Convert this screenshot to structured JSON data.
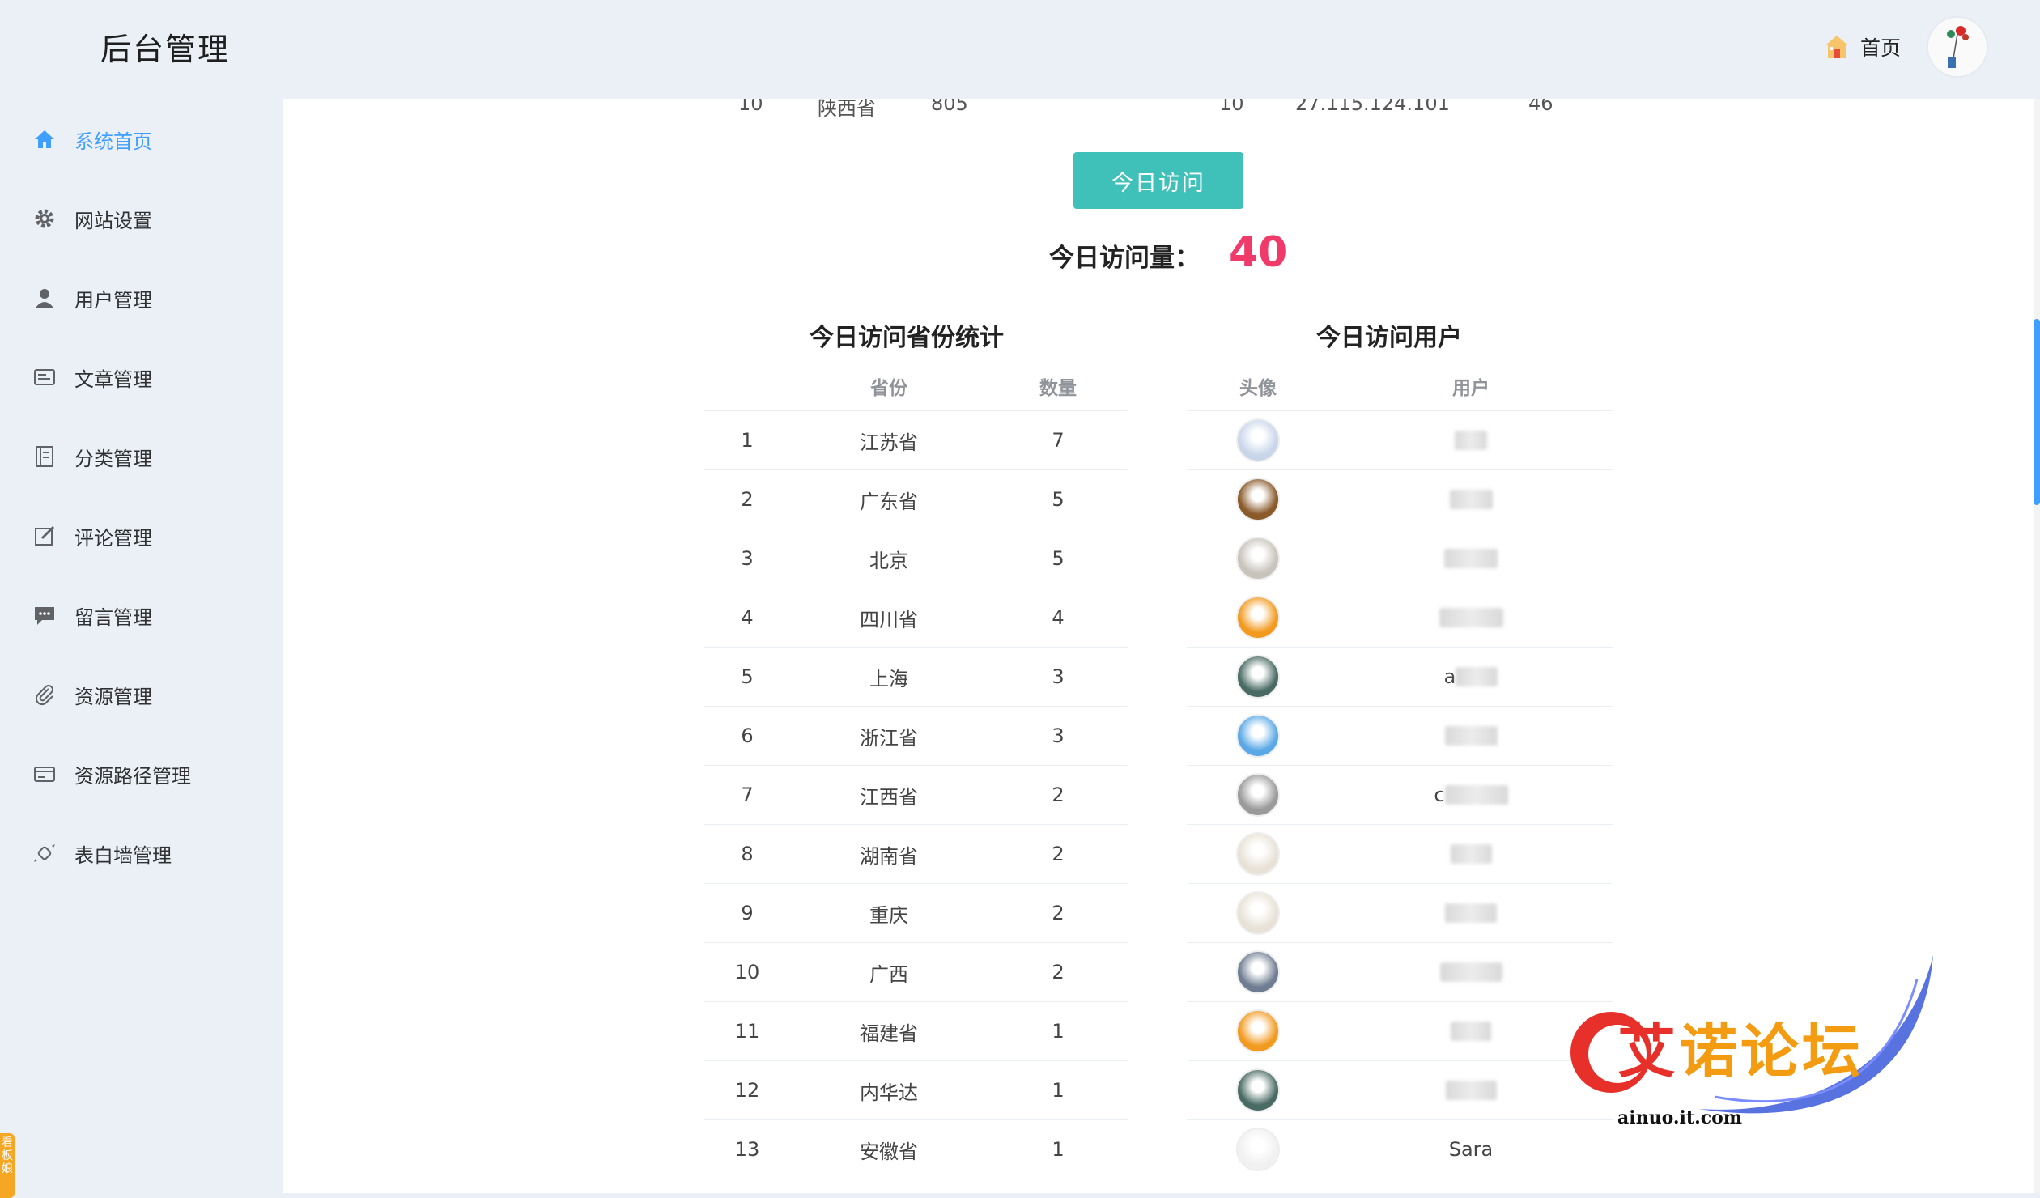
{
  "header": {
    "brand": "后台管理",
    "home_label": "首页"
  },
  "sidebar": {
    "items": [
      {
        "label": "系统首页",
        "icon": "home-icon",
        "active": true
      },
      {
        "label": "网站设置",
        "icon": "gear-icon"
      },
      {
        "label": "用户管理",
        "icon": "user-icon"
      },
      {
        "label": "文章管理",
        "icon": "article-icon"
      },
      {
        "label": "分类管理",
        "icon": "list-icon"
      },
      {
        "label": "评论管理",
        "icon": "edit-icon"
      },
      {
        "label": "留言管理",
        "icon": "message-icon"
      },
      {
        "label": "资源管理",
        "icon": "paperclip-icon"
      },
      {
        "label": "资源路径管理",
        "icon": "card-icon"
      },
      {
        "label": "表白墙管理",
        "icon": "candy-icon"
      }
    ],
    "side_tab": "看板娘"
  },
  "colors": {
    "accent": "#409eff",
    "button": "#3fc0b8",
    "count": "#f03a6a"
  },
  "prev_row": {
    "left_index": "10",
    "left_province": "陕西省",
    "left_count": "805",
    "right_index": "10",
    "right_ip": "27.115.124.101",
    "right_count": "46"
  },
  "today": {
    "button": "今日访问",
    "count_label": "今日访问量：",
    "count_value": "40"
  },
  "province_table": {
    "title": "今日访问省份统计",
    "headers": [
      "",
      "省份",
      "数量"
    ],
    "rows": [
      {
        "index": "1",
        "province": "江苏省",
        "count": "7"
      },
      {
        "index": "2",
        "province": "广东省",
        "count": "5"
      },
      {
        "index": "3",
        "province": "北京",
        "count": "5"
      },
      {
        "index": "4",
        "province": "四川省",
        "count": "4"
      },
      {
        "index": "5",
        "province": "上海",
        "count": "3"
      },
      {
        "index": "6",
        "province": "浙江省",
        "count": "3"
      },
      {
        "index": "7",
        "province": "江西省",
        "count": "2"
      },
      {
        "index": "8",
        "province": "湖南省",
        "count": "2"
      },
      {
        "index": "9",
        "province": "重庆",
        "count": "2"
      },
      {
        "index": "10",
        "province": "广西",
        "count": "2"
      },
      {
        "index": "11",
        "province": "福建省",
        "count": "1"
      },
      {
        "index": "12",
        "province": "内华达",
        "count": "1"
      },
      {
        "index": "13",
        "province": "安徽省",
        "count": "1"
      }
    ]
  },
  "user_table": {
    "title": "今日访问用户",
    "headers": [
      "头像",
      "用户"
    ],
    "rows": [
      {
        "avatar": "avatar-image",
        "user": "",
        "color": "#c9d6ea"
      },
      {
        "avatar": "avatar-image",
        "user": "",
        "color": "#8a5a2b"
      },
      {
        "avatar": "avatar-image",
        "user": "",
        "color": "#c8c3bb"
      },
      {
        "avatar": "avatar-image",
        "user": "",
        "color": "#f29a1f"
      },
      {
        "avatar": "avatar-image",
        "user": "a",
        "color": "#4a6b64"
      },
      {
        "avatar": "avatar-image",
        "user": "",
        "color": "#5aa9e6"
      },
      {
        "avatar": "avatar-image",
        "user": "c",
        "color": "#9a9a9a"
      },
      {
        "avatar": "avatar-image",
        "user": "",
        "color": "#e8e2d6"
      },
      {
        "avatar": "avatar-image",
        "user": "",
        "color": "#e8e2d6"
      },
      {
        "avatar": "avatar-image",
        "user": "",
        "color": "#6f7d92"
      },
      {
        "avatar": "avatar-image",
        "user": "",
        "color": "#f29a1f"
      },
      {
        "avatar": "avatar-image",
        "user": "",
        "color": "#4a6b64"
      },
      {
        "avatar": "avatar-image",
        "user": "Sara",
        "color": "#f1f1f1"
      }
    ]
  },
  "watermark": {
    "text_a": "艾",
    "text_b": "诺论坛",
    "url": "ainuo.it.com"
  }
}
